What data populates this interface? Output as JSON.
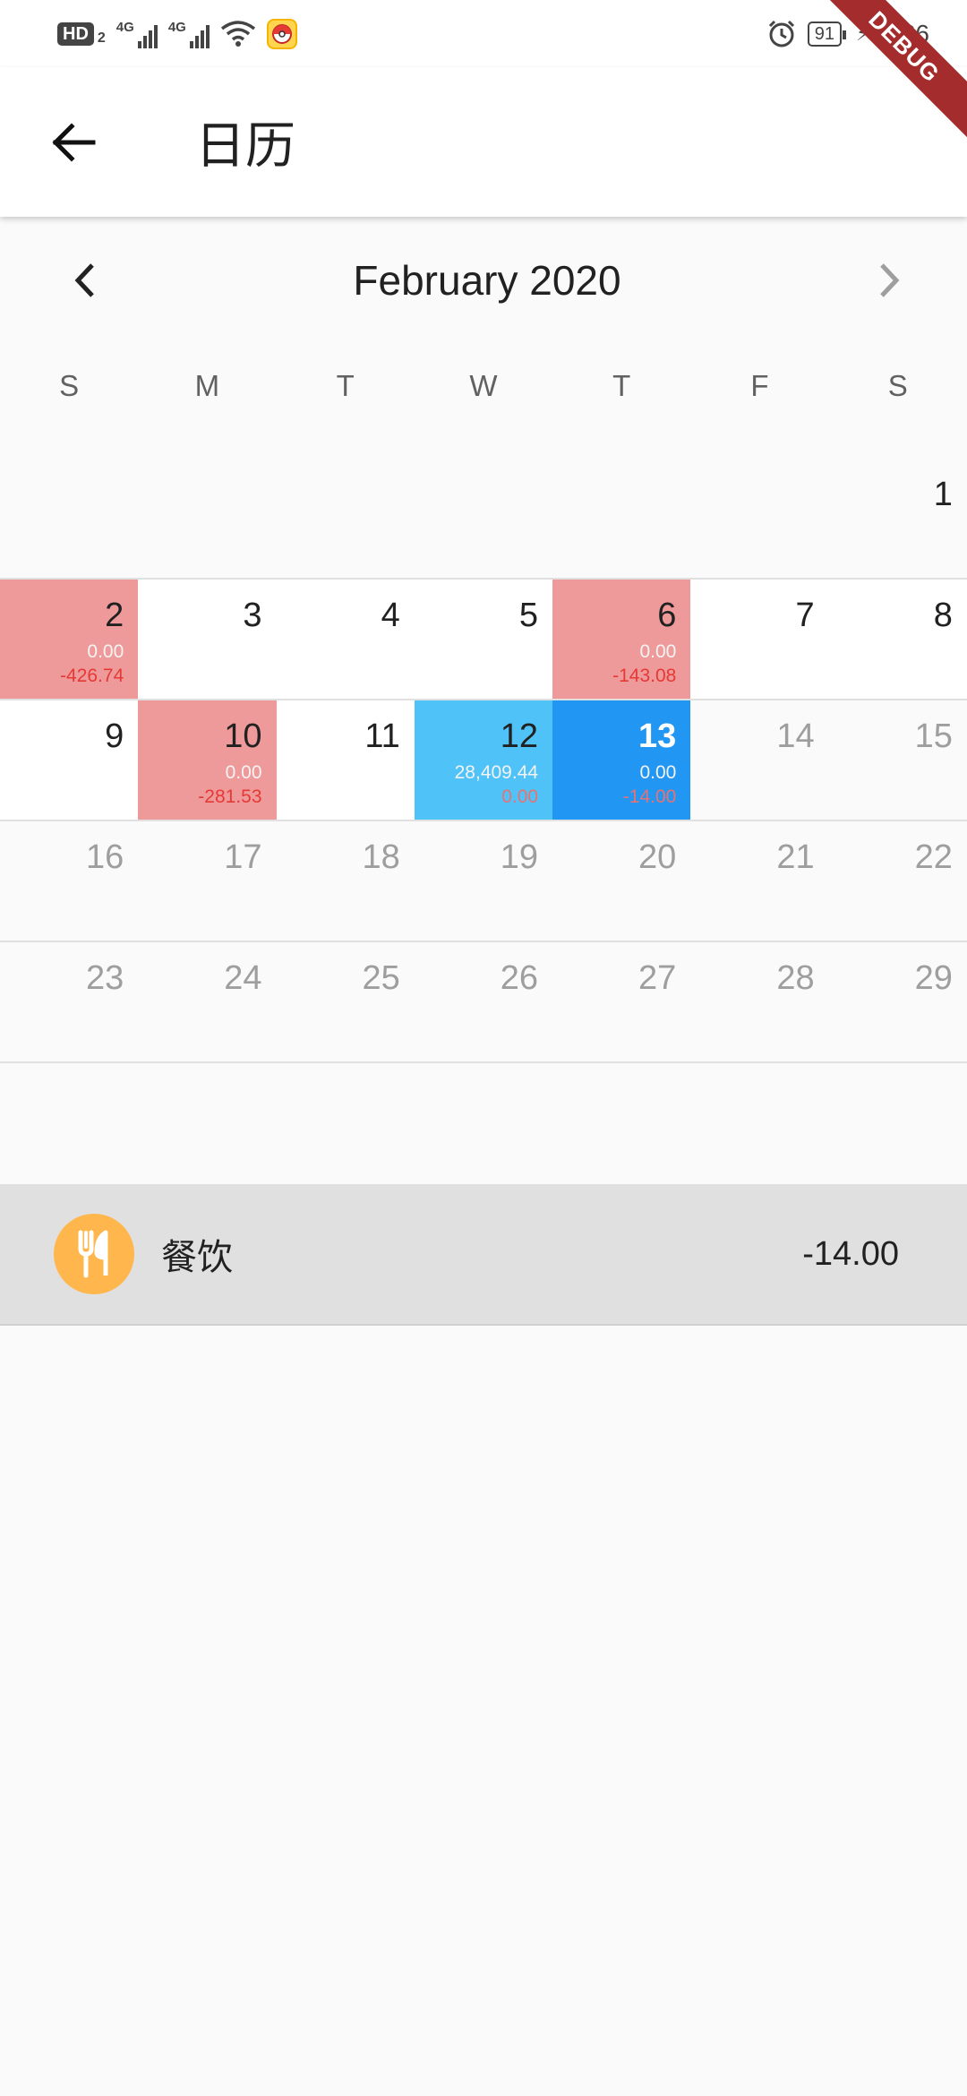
{
  "status_bar": {
    "hd_label": "HD",
    "sim_num": "2",
    "net1": "4G",
    "net2": "4G",
    "battery": "91",
    "time": "3:26",
    "app_icon": "pokeball-app-icon"
  },
  "debug_banner": "DEBUG",
  "app_bar": {
    "title": "日历",
    "back_icon": "arrow-left-icon"
  },
  "calendar": {
    "month_title": "February 2020",
    "prev_icon": "chevron-left-icon",
    "next_icon": "chevron-right-icon",
    "weekdays": [
      "S",
      "M",
      "T",
      "W",
      "T",
      "F",
      "S"
    ],
    "weeks": [
      [
        {
          "day": ""
        },
        {
          "day": ""
        },
        {
          "day": ""
        },
        {
          "day": ""
        },
        {
          "day": ""
        },
        {
          "day": ""
        },
        {
          "day": "1"
        }
      ],
      [
        {
          "day": "2",
          "income": "0.00",
          "expense": "-426.74",
          "style": "red"
        },
        {
          "day": "3",
          "style": "white"
        },
        {
          "day": "4",
          "style": "white"
        },
        {
          "day": "5",
          "style": "white"
        },
        {
          "day": "6",
          "income": "0.00",
          "expense": "-143.08",
          "style": "red"
        },
        {
          "day": "7",
          "style": "white"
        },
        {
          "day": "8",
          "style": "white"
        }
      ],
      [
        {
          "day": "9",
          "style": "white"
        },
        {
          "day": "10",
          "income": "0.00",
          "expense": "-281.53",
          "style": "red"
        },
        {
          "day": "11",
          "style": "white"
        },
        {
          "day": "12",
          "income": "28,409.44",
          "expense": "0.00",
          "style": "lightblue"
        },
        {
          "day": "13",
          "income": "0.00",
          "expense": "-14.00",
          "style": "blue"
        },
        {
          "day": "14",
          "faded": true
        },
        {
          "day": "15",
          "faded": true
        }
      ],
      [
        {
          "day": "16",
          "faded": true
        },
        {
          "day": "17",
          "faded": true
        },
        {
          "day": "18",
          "faded": true
        },
        {
          "day": "19",
          "faded": true
        },
        {
          "day": "20",
          "faded": true
        },
        {
          "day": "21",
          "faded": true
        },
        {
          "day": "22",
          "faded": true
        }
      ],
      [
        {
          "day": "23",
          "faded": true
        },
        {
          "day": "24",
          "faded": true
        },
        {
          "day": "25",
          "faded": true
        },
        {
          "day": "26",
          "faded": true
        },
        {
          "day": "27",
          "faded": true
        },
        {
          "day": "28",
          "faded": true
        },
        {
          "day": "29",
          "faded": true
        }
      ]
    ],
    "colors": {
      "red_cell": "#ef9a9a",
      "lightblue_cell": "#4fc3f7",
      "selected_cell": "#2196f3",
      "expense_text": "#e53935"
    }
  },
  "transactions": [
    {
      "category": "餐饮",
      "amount": "-14.00",
      "icon": "fork-knife-icon",
      "icon_color": "#ffb74d"
    }
  ]
}
